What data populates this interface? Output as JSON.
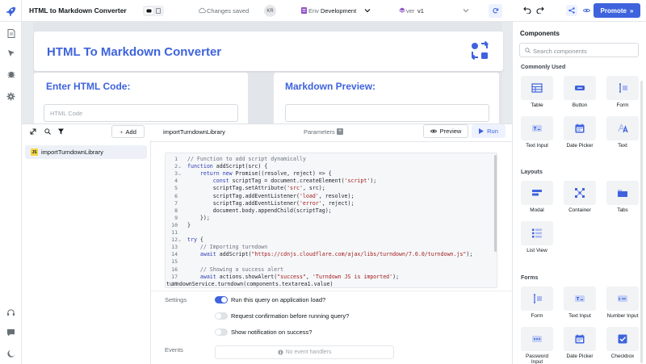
{
  "app": {
    "title": "HTML to Markdown Converter",
    "save_status": "Changes saved",
    "user_initials": "KR",
    "env_label": "Env",
    "env_value": "Development",
    "version_label": "ver",
    "version_value": "v1",
    "promote_label": "Promote",
    "accent_color": "#3e63dd"
  },
  "canvas": {
    "title": "HTML To Markdown Converter",
    "input_heading": "Enter HTML Code:",
    "input_placeholder": "HTML Code",
    "preview_heading": "Markdown Preview:"
  },
  "query_panel": {
    "add_label": "Add",
    "queries": [
      {
        "name": "importTurndownLibrary",
        "type_badge": "JS"
      }
    ],
    "active_query": "importTurndownLibrary",
    "parameters_label": "Parameters",
    "preview_label": "Preview",
    "run_label": "Run",
    "code_lines": [
      "// Function to add script dynamically",
      "function addScript(src) {",
      "    return new Promise((resolve, reject) => {",
      "        const scriptTag = document.createElement('script');",
      "        scriptTag.setAttribute('src', src);",
      "        scriptTag.addEventListener('load', resolve);",
      "        scriptTag.addEventListener('error', reject);",
      "        document.body.appendChild(scriptTag);",
      "    });",
      "}",
      "",
      "try {",
      "    // Importing turndown",
      "    await addScript(\"https://cdnjs.cloudflare.com/ajax/libs/turndown/7.0.0/turndown.js\");",
      "",
      "    // Showing a success alert",
      "    await actions.showAlert(\"success\", 'Turndown JS is imported');",
      "turndownService.turndown(components.textarea1.value)"
    ],
    "settings_label": "Settings",
    "options": [
      {
        "label": "Run this query on application load?",
        "on": true
      },
      {
        "label": "Request confirmation before running query?",
        "on": false
      },
      {
        "label": "Show notification on success?",
        "on": false
      }
    ],
    "events_label": "Events",
    "no_events_text": "No event handlers"
  },
  "components_panel": {
    "title": "Components",
    "search_placeholder": "Search components",
    "sections": [
      {
        "name": "Commonly Used",
        "items": [
          {
            "label": "Table",
            "icon": "table-icon"
          },
          {
            "label": "Button",
            "icon": "button-icon"
          },
          {
            "label": "Form",
            "icon": "form-icon"
          },
          {
            "label": "Text Input",
            "icon": "text-input-icon"
          },
          {
            "label": "Date Picker",
            "icon": "calendar-icon"
          },
          {
            "label": "Text",
            "icon": "text-icon"
          }
        ]
      },
      {
        "name": "Layouts",
        "items": [
          {
            "label": "Modal",
            "icon": "modal-icon"
          },
          {
            "label": "Container",
            "icon": "container-icon"
          },
          {
            "label": "Tabs",
            "icon": "tabs-icon"
          },
          {
            "label": "List View",
            "icon": "list-view-icon"
          }
        ]
      },
      {
        "name": "Forms",
        "items": [
          {
            "label": "Form",
            "icon": "form-icon"
          },
          {
            "label": "Text Input",
            "icon": "text-input-icon"
          },
          {
            "label": "Number Input",
            "icon": "number-input-icon"
          },
          {
            "label": "Password Input",
            "icon": "password-input-icon"
          },
          {
            "label": "Date Picker",
            "icon": "calendar-icon"
          },
          {
            "label": "Checkbox",
            "icon": "checkbox-icon"
          }
        ]
      }
    ]
  }
}
